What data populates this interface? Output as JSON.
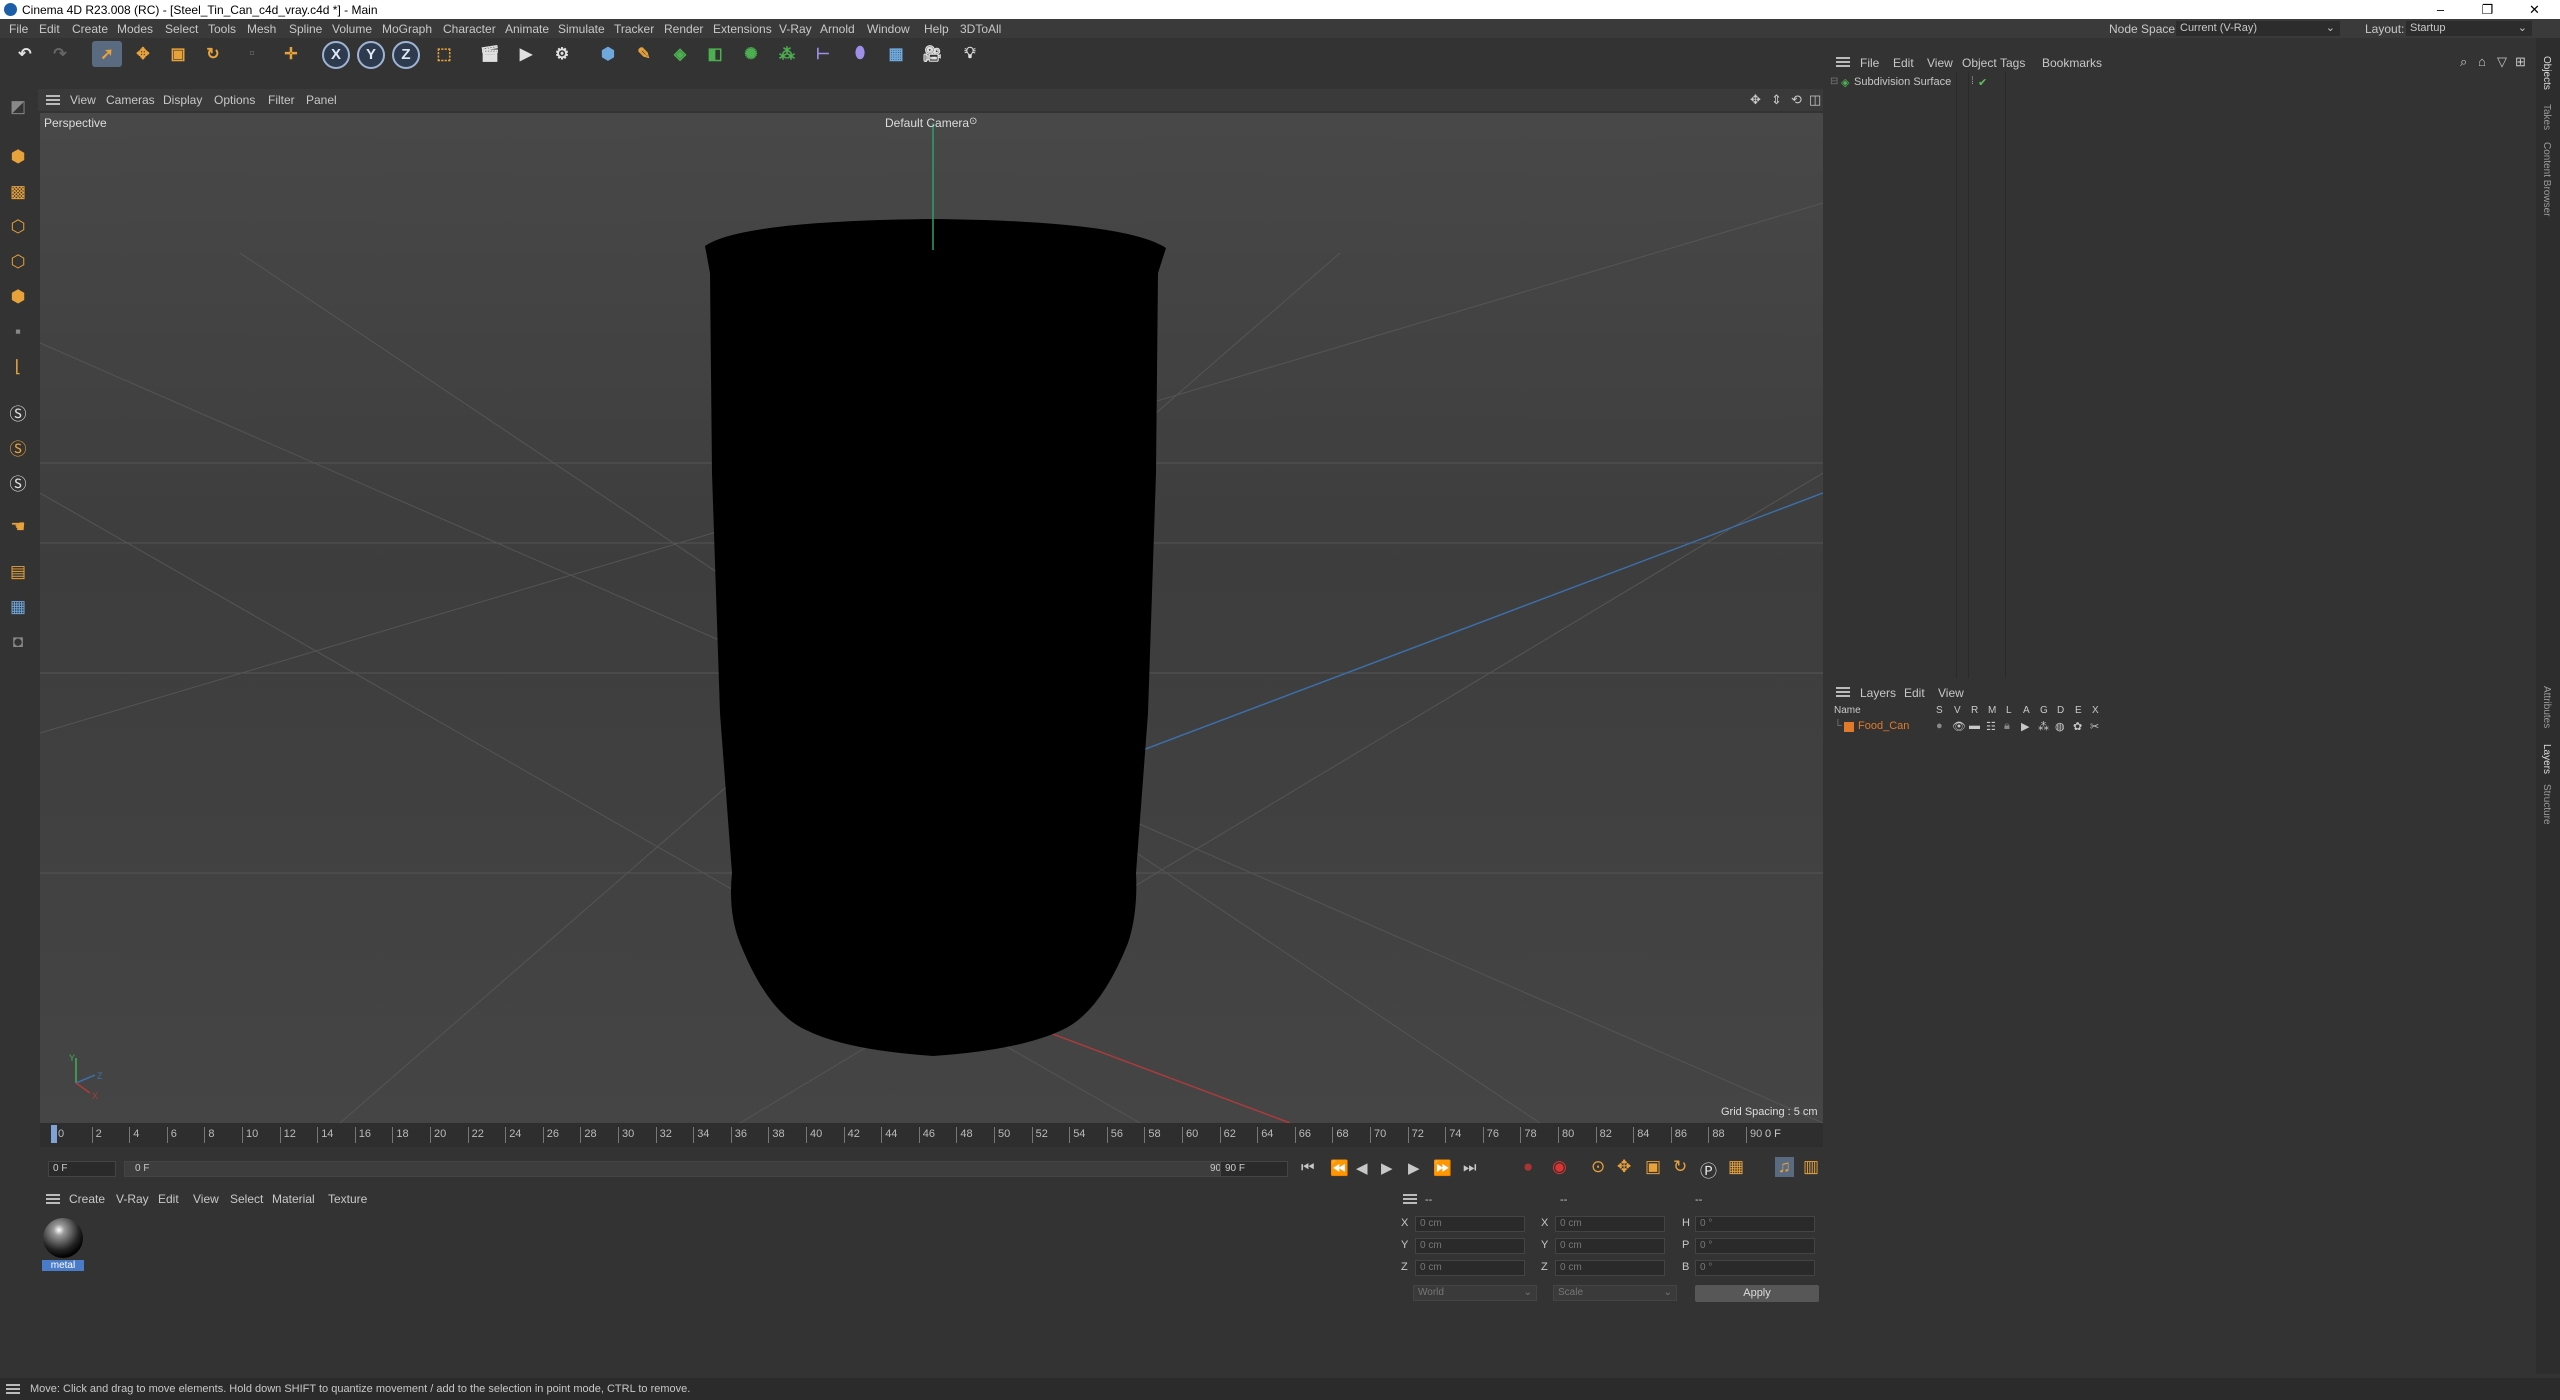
{
  "titlebar": {
    "title": "Cinema 4D R23.008 (RC) - [Steel_Tin_Can_c4d_vray.c4d *] - Main",
    "minimize": "–",
    "maximize": "❐",
    "close": "✕"
  },
  "menubar": {
    "items": [
      "File",
      "Edit",
      "Create",
      "Modes",
      "Select",
      "Tools",
      "Mesh",
      "Spline",
      "Volume",
      "MoGraph",
      "Character",
      "Animate",
      "Simulate",
      "Tracker",
      "Render",
      "Extensions",
      "V-Ray",
      "Arnold",
      "Window",
      "Help",
      "3DToAll"
    ],
    "node_space_label": "Node Space:",
    "node_space_value": "Current (V-Ray)",
    "layout_label": "Layout:",
    "layout_value": "Startup"
  },
  "viewport": {
    "menu": [
      "View",
      "Cameras",
      "Display",
      "Options",
      "Filter",
      "Panel"
    ],
    "view_name": "Perspective",
    "camera_label": "Default Camera",
    "grid_spacing": "Grid Spacing : 5 cm"
  },
  "timeline": {
    "ticks": [
      "0",
      "2",
      "4",
      "6",
      "8",
      "10",
      "12",
      "14",
      "16",
      "18",
      "20",
      "22",
      "24",
      "26",
      "28",
      "30",
      "32",
      "34",
      "36",
      "38",
      "40",
      "42",
      "44",
      "46",
      "48",
      "50",
      "52",
      "54",
      "56",
      "58",
      "60",
      "62",
      "64",
      "66",
      "68",
      "70",
      "72",
      "74",
      "76",
      "78",
      "80",
      "82",
      "84",
      "86",
      "88",
      "90"
    ],
    "current_frame": "0 F"
  },
  "transport": {
    "start_field": "0 F",
    "min_field": "0 F",
    "max_label": "90 F",
    "end_field": "90 F"
  },
  "materials": {
    "menu": [
      "Create",
      "V-Ray",
      "Edit",
      "View",
      "Select",
      "Material",
      "Texture"
    ],
    "items": [
      {
        "name": "metal"
      }
    ]
  },
  "coords": {
    "header_dashes": [
      "--",
      "--",
      "--"
    ],
    "rows": [
      {
        "a": "X",
        "av": "0 cm",
        "b": "X",
        "bv": "0 cm",
        "c": "H",
        "cv": "0 °"
      },
      {
        "a": "Y",
        "av": "0 cm",
        "b": "Y",
        "bv": "0 cm",
        "c": "P",
        "cv": "0 °"
      },
      {
        "a": "Z",
        "av": "0 cm",
        "b": "Z",
        "bv": "0 cm",
        "c": "B",
        "cv": "0 °"
      }
    ],
    "space": "World",
    "mode": "Scale",
    "apply": "Apply"
  },
  "objects": {
    "menu": [
      "File",
      "Edit",
      "View",
      "Object",
      "Tags",
      "Bookmarks"
    ],
    "items": [
      {
        "name": "Subdivision Surface"
      }
    ]
  },
  "layers": {
    "menu": [
      "Layers",
      "Edit",
      "View"
    ],
    "col_name": "Name",
    "cols": [
      "S",
      "V",
      "R",
      "M",
      "L",
      "A",
      "G",
      "D",
      "E",
      "X"
    ],
    "items": [
      {
        "name": "Food_Can",
        "color": "#e07a2a"
      }
    ]
  },
  "sidetabs": {
    "top": [
      "Objects",
      "Takes",
      "Content Browser"
    ],
    "bottom": [
      "Attributes",
      "Layers",
      "Structure"
    ]
  },
  "status": "Move: Click and drag to move elements. Hold down SHIFT to quantize movement / add to the selection in point mode, CTRL to remove."
}
